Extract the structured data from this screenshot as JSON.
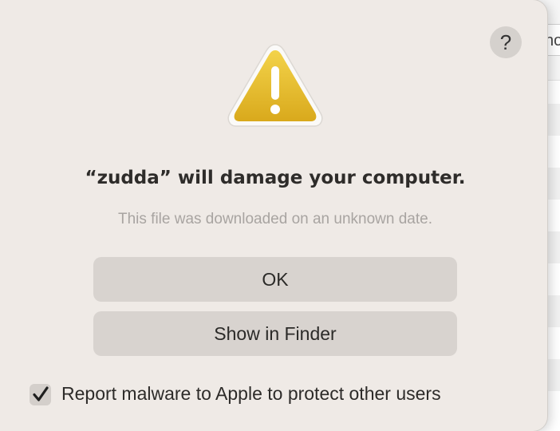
{
  "background": {
    "partial_tab_text": "no"
  },
  "dialog": {
    "help_label": "?",
    "title": "“zudda” will damage your computer.",
    "subtitle": "This file was downloaded on an unknown date.",
    "ok_label": "OK",
    "show_in_finder_label": "Show in Finder",
    "report_checkbox": {
      "checked": true,
      "label": "Report malware to Apple to protect other users"
    },
    "warning_icon": "warning-triangle-icon"
  },
  "colors": {
    "dialog_bg": "#efeae6",
    "button_bg": "#d8d3cf",
    "warning_yellow": "#e7be2e"
  }
}
